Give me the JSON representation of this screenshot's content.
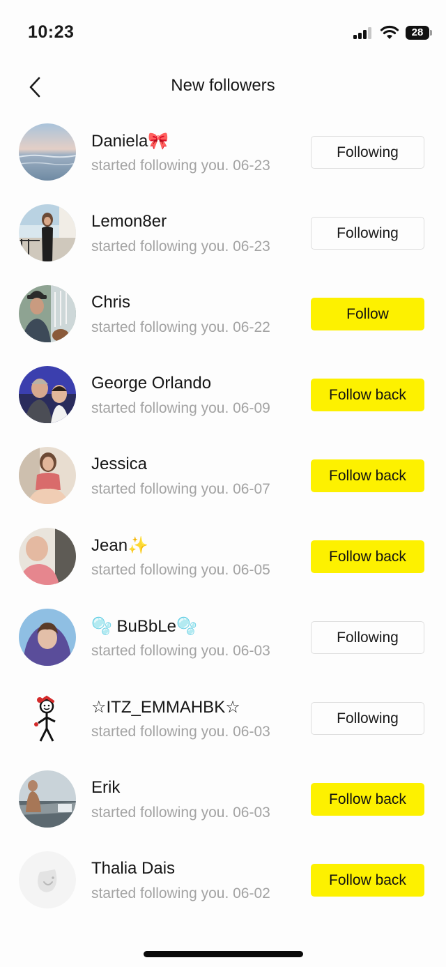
{
  "status_bar": {
    "time": "10:23",
    "battery": "28"
  },
  "header": {
    "title": "New followers"
  },
  "followers": [
    {
      "name": "Daniela🎀",
      "subtitle": "started following you. 06-23",
      "button": "Following",
      "button_style": "outline"
    },
    {
      "name": "Lemon8er",
      "subtitle": "started following you. 06-23",
      "button": "Following",
      "button_style": "outline"
    },
    {
      "name": "Chris",
      "subtitle": "started following you. 06-22",
      "button": "Follow",
      "button_style": "yellow"
    },
    {
      "name": "George Orlando",
      "subtitle": "started following you. 06-09",
      "button": "Follow back",
      "button_style": "yellow"
    },
    {
      "name": "Jessica",
      "subtitle": "started following you. 06-07",
      "button": "Follow back",
      "button_style": "yellow"
    },
    {
      "name": "Jean✨",
      "subtitle": "started following you. 06-05",
      "button": "Follow back",
      "button_style": "yellow"
    },
    {
      "name": "🫧 BuBbLe🫧",
      "subtitle": "started following you. 06-03",
      "button": "Following",
      "button_style": "outline"
    },
    {
      "name": "☆ITZ_EMMAHBK☆",
      "subtitle": "started following you. 06-03",
      "button": "Following",
      "button_style": "outline"
    },
    {
      "name": "Erik",
      "subtitle": "started following you. 06-03",
      "button": "Follow back",
      "button_style": "yellow"
    },
    {
      "name": "Thalia Dais",
      "subtitle": "started following you. 06-02",
      "button": "Follow back",
      "button_style": "yellow"
    }
  ],
  "colors": {
    "accent_yellow": "#fdf100",
    "subtitle_gray": "#a3a3a3",
    "outline_border": "#dedede"
  }
}
